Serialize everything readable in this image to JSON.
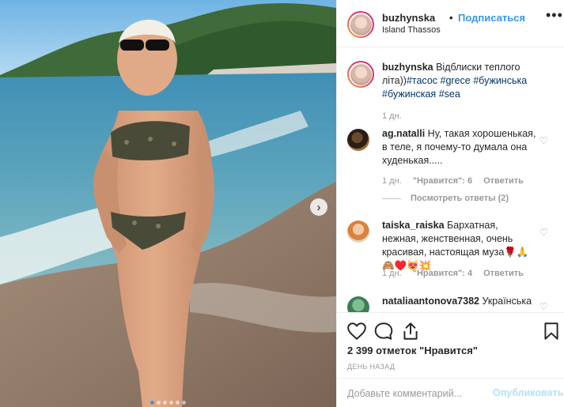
{
  "post": {
    "username": "buzhynska",
    "separator": "•",
    "follow_label": "Подписаться",
    "location": "Island Thassos",
    "more_label": "•••",
    "carousel_next": "›",
    "carousel_count": 6,
    "carousel_active": 1
  },
  "caption": {
    "username": "buzhynska",
    "text": "Відблиски теплого літа))",
    "tags": [
      "#тасос",
      "#grece",
      "#бужинська",
      "#бужинская",
      "#sea"
    ],
    "time": "1 дн."
  },
  "comments": [
    {
      "username": "ag.natalli",
      "text": "Ну, такая хорошенькая, в теле, я почему-то думала она худенькая.....",
      "time": "1 дн.",
      "likes": "\"Нравится\": 6",
      "reply": "Ответить",
      "view_replies": "Посмотреть ответы (2)",
      "heart": "♡"
    },
    {
      "username": "taiska_raiska",
      "text": "Бархатная, нежная, женственная, очень красивая, настоящая муза🌹🙏🙈♥️😻💥",
      "time": "1 дн.",
      "likes": "\"Нравится\": 4",
      "reply": "Ответить",
      "heart": "♡"
    },
    {
      "username": "nataliaantonova7382",
      "text": "Українська",
      "heart": "♡"
    }
  ],
  "actions": {
    "like_icon": "heart-icon",
    "comment_icon": "comment-icon",
    "share_icon": "share-icon",
    "save_icon": "bookmark-icon",
    "likes_text": "2 399 отметок \"Нравится\"",
    "time_ago": "ДЕНЬ НАЗАД"
  },
  "composer": {
    "placeholder": "Добавьте комментарий...",
    "publish_label": "Опубликовать"
  },
  "colors": {
    "link_blue": "#3897f0",
    "hashtag": "#003569",
    "muted": "#999999",
    "publish_disabled": "#b2dffc"
  }
}
